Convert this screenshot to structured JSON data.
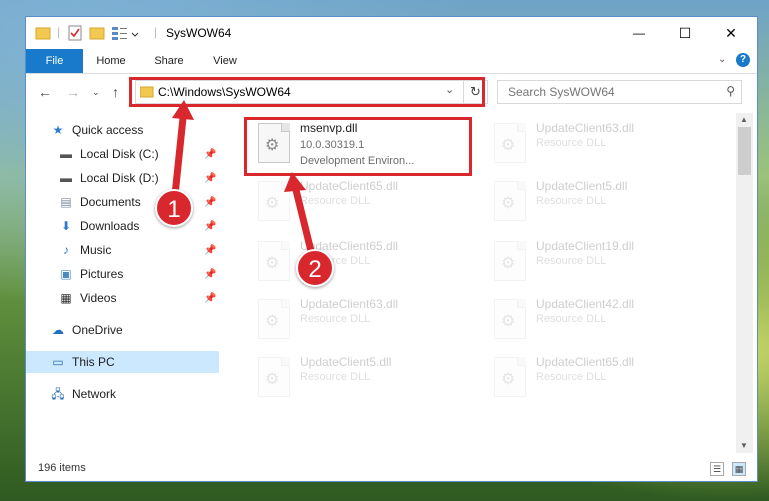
{
  "window": {
    "title": "SysWOW64",
    "minimize": "—",
    "maximize": "☐",
    "close": "✕"
  },
  "ribbon": {
    "tabs": [
      "File",
      "Home",
      "Share",
      "View"
    ]
  },
  "address": {
    "path": "C:\\Windows\\SysWOW64",
    "search_placeholder": "Search SysWOW64"
  },
  "sidebar": {
    "items": [
      {
        "label": "Quick access",
        "icon": "star-icon"
      },
      {
        "label": "Local Disk (C:)",
        "icon": "drive-icon",
        "pinned": true
      },
      {
        "label": "Local Disk (D:)",
        "icon": "drive-icon",
        "pinned": true
      },
      {
        "label": "Documents",
        "icon": "documents-icon",
        "pinned": true
      },
      {
        "label": "Downloads",
        "icon": "downloads-icon",
        "pinned": true
      },
      {
        "label": "Music",
        "icon": "music-icon",
        "pinned": true
      },
      {
        "label": "Pictures",
        "icon": "pictures-icon",
        "pinned": true
      },
      {
        "label": "Videos",
        "icon": "videos-icon",
        "pinned": true
      },
      {
        "label": "OneDrive",
        "icon": "onedrive-icon"
      },
      {
        "label": "This PC",
        "icon": "this-pc-icon",
        "selected": true
      },
      {
        "label": "Network",
        "icon": "network-icon"
      }
    ]
  },
  "files": {
    "main": {
      "name": "msenvp.dll",
      "version": "10.0.30319.1",
      "description": "Development Environ..."
    },
    "left_column": [
      {
        "name": "UpdateClient65.dll",
        "type": "Resource DLL"
      },
      {
        "name": "UpdateClient65.dll",
        "type": "Resource DLL"
      },
      {
        "name": "UpdateClient63.dll",
        "type": "Resource DLL"
      },
      {
        "name": "UpdateClient5.dll",
        "type": "Resource DLL"
      }
    ],
    "right_column": [
      {
        "name": "UpdateClient63.dll",
        "type": "Resource DLL"
      },
      {
        "name": "UpdateClient5.dll",
        "type": "Resource DLL"
      },
      {
        "name": "UpdateClient19.dll",
        "type": "Resource DLL"
      },
      {
        "name": "UpdateClient42.dll",
        "type": "Resource DLL"
      },
      {
        "name": "UpdateClient65.dll",
        "type": "Resource DLL"
      }
    ]
  },
  "status": {
    "count": "196 items"
  },
  "annotations": {
    "callout_1": "1",
    "callout_2": "2"
  },
  "colors": {
    "accent": "#1979ca",
    "highlight": "#d9272e",
    "selected": "#cce8ff"
  }
}
